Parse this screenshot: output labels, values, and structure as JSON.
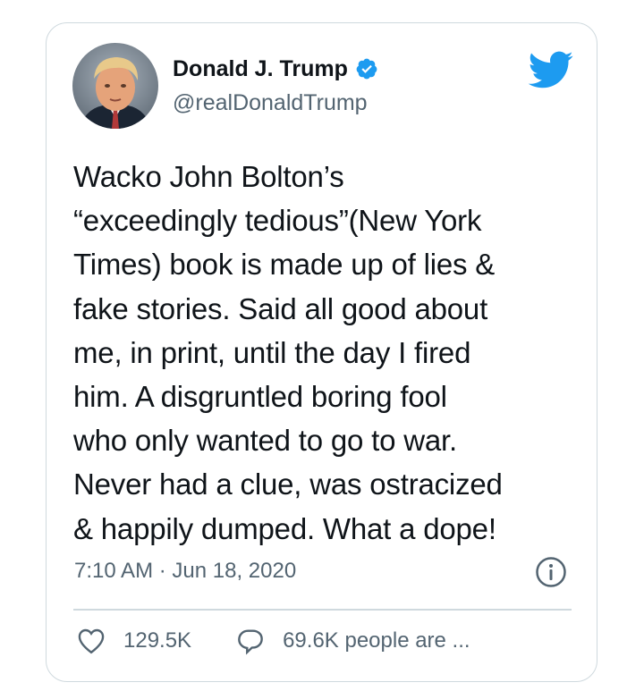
{
  "tweet": {
    "author": {
      "display_name": "Donald J. Trump",
      "handle": "@realDonaldTrump",
      "verified": true
    },
    "text": "Wacko John Bolton’s\n“exceedingly tedious”(New York\nTimes) book is made up of lies &\nfake stories. Said all good about\nme, in print, until the day I fired\nhim. A disgruntled boring fool\nwho only wanted to go to war.\nNever had a clue, was ostracized\n& happily dumped. What a dope!",
    "timestamp": "7:10 AM · Jun 18, 2020",
    "likes": "129.5K",
    "replies": "69.6K people are ..."
  },
  "icons": {
    "brand": "twitter-bird-icon",
    "verified": "verified-badge-icon",
    "info": "info-icon",
    "like": "heart-icon",
    "reply": "reply-bubble-icon"
  },
  "colors": {
    "brand_blue": "#1d9bf0",
    "text_primary": "#0f1419",
    "text_secondary": "#536471",
    "border": "#cfd9de"
  }
}
